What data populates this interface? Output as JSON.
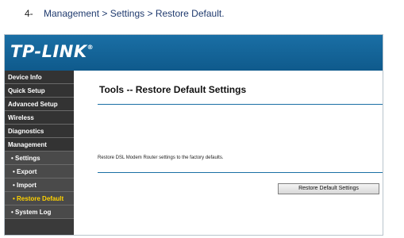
{
  "instruction": {
    "number": "4-",
    "crumb_1": "Management",
    "sep": ">",
    "crumb_2": "Settings",
    "crumb_3": "Restore Default",
    "suffix": "."
  },
  "logo": {
    "text": "TP-LINK",
    "mark": "®"
  },
  "sidebar": {
    "items": [
      {
        "label": "Device Info"
      },
      {
        "label": "Quick Setup"
      },
      {
        "label": "Advanced Setup"
      },
      {
        "label": "Wireless"
      },
      {
        "label": "Diagnostics"
      },
      {
        "label": "Management"
      },
      {
        "label": "• Settings"
      },
      {
        "label": "• Export"
      },
      {
        "label": "• Import"
      },
      {
        "label": "• Restore Default"
      },
      {
        "label": "• System Log"
      }
    ]
  },
  "content": {
    "title": "Tools -- Restore Default Settings",
    "description": "Restore DSL Modem Router settings to the factory defaults.",
    "button_label": "Restore Default Settings"
  },
  "colors": {
    "header": "#1a6fa5",
    "sidebar": "#3a3a3a",
    "active_item": "#ffd200",
    "link": "#1f3a6e"
  }
}
